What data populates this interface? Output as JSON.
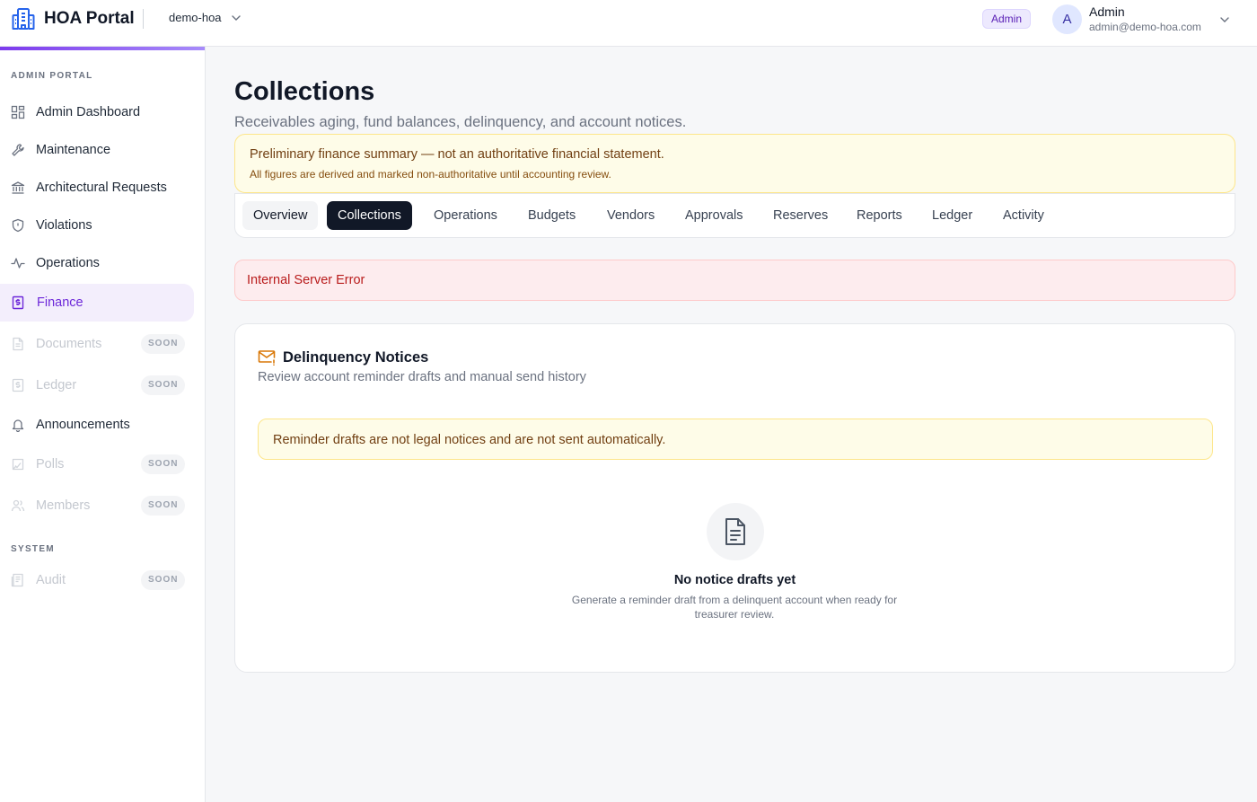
{
  "header": {
    "app_title": "HOA Portal",
    "org_name": "demo-hoa",
    "role_badge": "Admin",
    "user": {
      "initial": "A",
      "name": "Admin",
      "email": "admin@demo-hoa.com"
    }
  },
  "sidebar": {
    "admin_section_label": "ADMIN PORTAL",
    "system_section_label": "SYSTEM",
    "items": [
      {
        "label": "Admin Dashboard",
        "icon": "grid-icon",
        "state": "normal"
      },
      {
        "label": "Maintenance",
        "icon": "wrench-icon",
        "state": "normal"
      },
      {
        "label": "Architectural Requests",
        "icon": "building-columns-icon",
        "state": "normal"
      },
      {
        "label": "Violations",
        "icon": "shield-icon",
        "state": "normal"
      },
      {
        "label": "Operations",
        "icon": "activity-icon",
        "state": "normal"
      },
      {
        "label": "Finance",
        "icon": "receipt-dollar-icon",
        "state": "active"
      },
      {
        "label": "Documents",
        "icon": "document-icon",
        "state": "disabled",
        "badge": "SOON"
      },
      {
        "label": "Ledger",
        "icon": "ledger-icon",
        "state": "disabled",
        "badge": "SOON"
      },
      {
        "label": "Announcements",
        "icon": "bell-icon",
        "state": "normal"
      },
      {
        "label": "Polls",
        "icon": "poll-icon",
        "state": "disabled",
        "badge": "SOON"
      },
      {
        "label": "Members",
        "icon": "users-icon",
        "state": "disabled",
        "badge": "SOON"
      }
    ],
    "system_items": [
      {
        "label": "Audit",
        "icon": "audit-icon",
        "state": "disabled",
        "badge": "SOON"
      }
    ]
  },
  "main": {
    "title": "Collections",
    "subtitle": "Receivables aging, fund balances, delinquency, and account notices.",
    "finance_banner": {
      "title": "Preliminary finance summary — not an authoritative financial statement.",
      "subtitle": "All figures are derived and marked non-authoritative until accounting review."
    },
    "tabs": [
      {
        "label": "Overview"
      },
      {
        "label": "Collections",
        "active": true
      },
      {
        "label": "Operations"
      },
      {
        "label": "Budgets"
      },
      {
        "label": "Vendors"
      },
      {
        "label": "Approvals"
      },
      {
        "label": "Reserves"
      },
      {
        "label": "Reports"
      },
      {
        "label": "Ledger"
      },
      {
        "label": "Activity"
      }
    ],
    "error_message": "Internal Server Error",
    "notices_card": {
      "title": "Delinquency Notices",
      "subtitle": "Review account reminder drafts and manual send history",
      "reminder_warning": "Reminder drafts are not legal notices and are not sent automatically.",
      "empty_title": "No notice drafts yet",
      "empty_description": "Generate a reminder draft from a delinquent account when ready for treasurer review."
    }
  },
  "colors": {
    "accent": "#6d28d9",
    "active_tab_bg": "#111827",
    "warning_bg": "#fefce8",
    "error_bg": "#fdecee",
    "error_text": "#b91c1c"
  }
}
